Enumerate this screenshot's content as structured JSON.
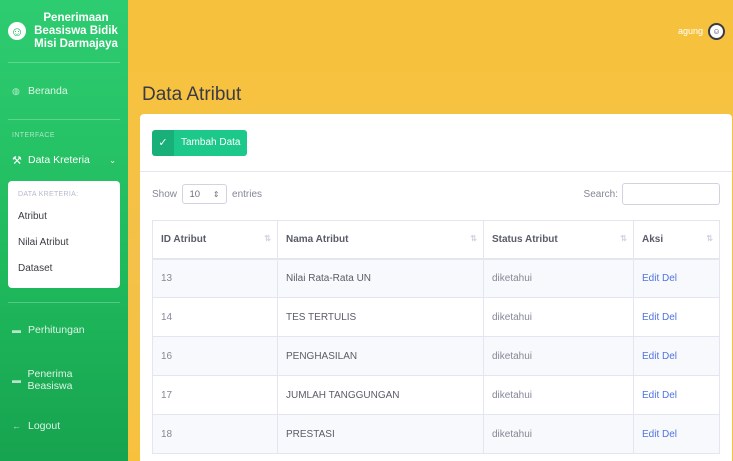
{
  "sidebar": {
    "brand_line1": "Penerimaan",
    "brand_line2": "Beasiswa Bidik",
    "brand_line3": "Misi Darmajaya",
    "beranda": "Beranda",
    "heading_interface": "INTERFACE",
    "data_kreteria": "Data Kreteria",
    "submenu_heading": "DATA KRETERIA:",
    "submenu_items": [
      "Atribut",
      "Nilai Atribut",
      "Dataset"
    ],
    "perhitungan": "Perhitungan",
    "penerima": "Penerima Beasiswa",
    "logout": "Logout"
  },
  "topbar": {
    "user": "agung"
  },
  "page": {
    "title": "Data Atribut",
    "add_button": "Tambah Data",
    "show_label": "Show",
    "show_value": "10",
    "entries_label": "entries",
    "search_label": "Search:"
  },
  "table": {
    "headers": [
      "ID Atribut",
      "Nama Atribut",
      "Status Atribut",
      "Aksi"
    ],
    "rows": [
      {
        "id": "13",
        "name": "Nilai Rata-Rata UN",
        "status": "diketahui",
        "action": "Edit Del"
      },
      {
        "id": "14",
        "name": "TES TERTULIS",
        "status": "diketahui",
        "action": "Edit Del"
      },
      {
        "id": "16",
        "name": "PENGHASILAN",
        "status": "diketahui",
        "action": "Edit Del"
      },
      {
        "id": "17",
        "name": "JUMLAH TANGGUNGAN",
        "status": "diketahui",
        "action": "Edit Del"
      },
      {
        "id": "18",
        "name": "PRESTASI",
        "status": "diketahui",
        "action": "Edit Del"
      }
    ]
  },
  "colors": {
    "sidebar": "#1fb95c",
    "topbar": "#f6c23e",
    "button": "#1cc88a",
    "link": "#4e73df"
  },
  "icons": {
    "brand": "smile-icon",
    "beranda": "dashboard-icon",
    "kreteria": "wrench-icon",
    "folder": "folder-icon",
    "logout": "arrow-left-icon",
    "check": "check-icon"
  }
}
